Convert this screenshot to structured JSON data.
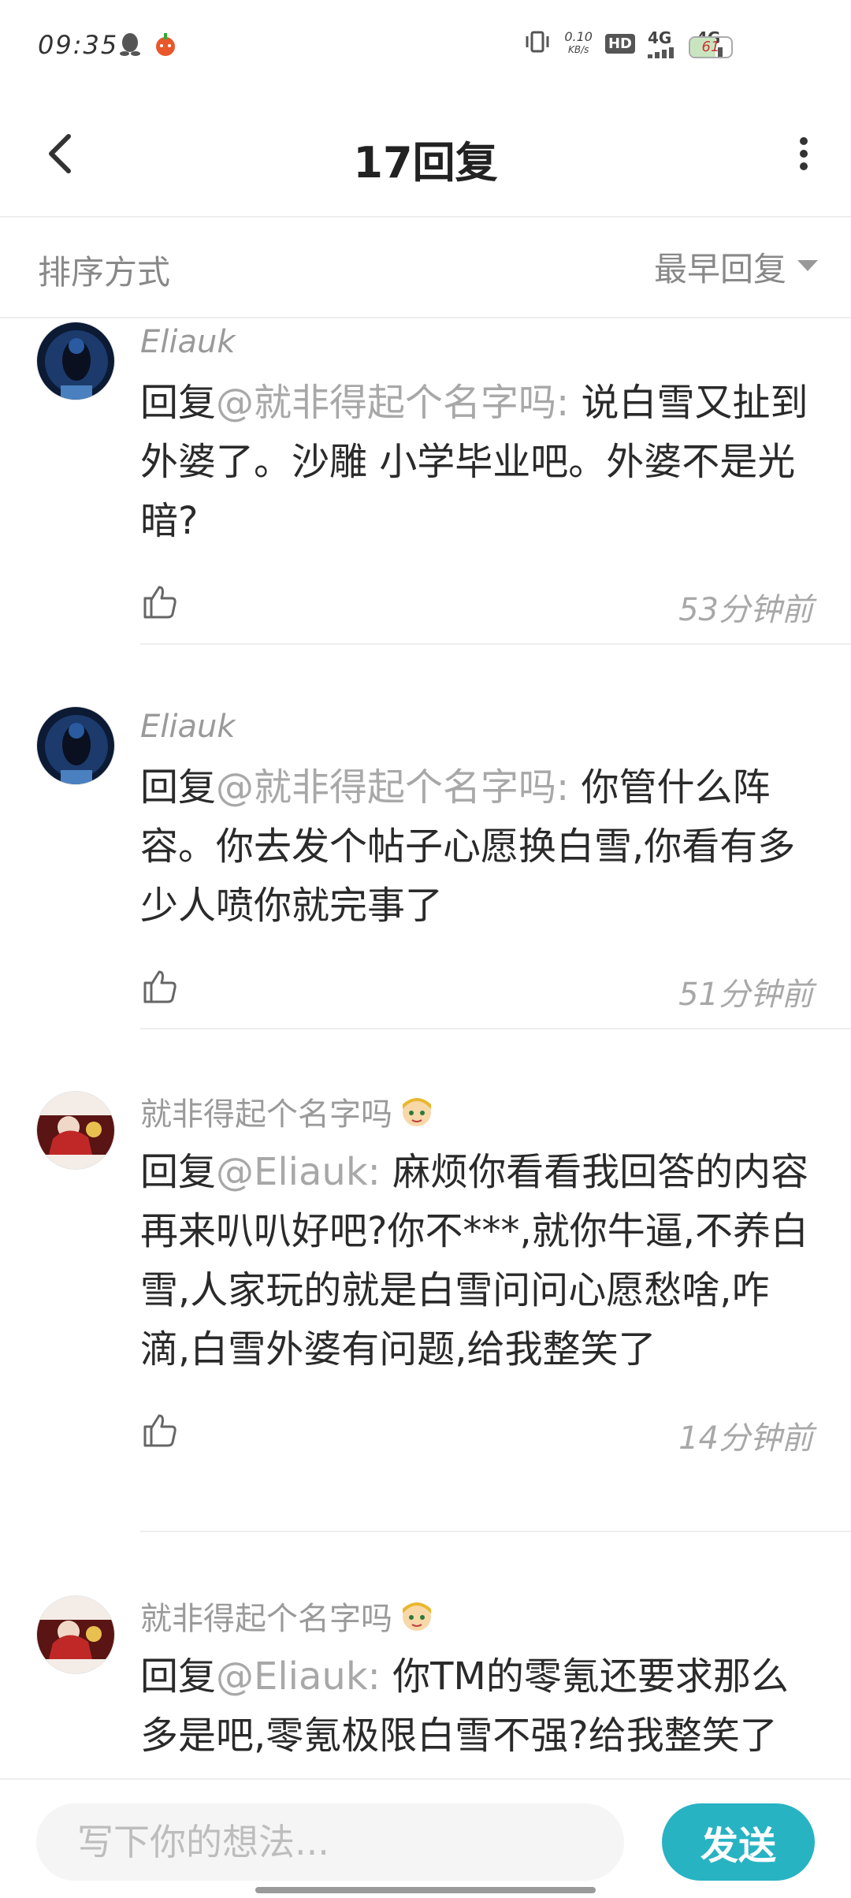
{
  "status_bar": {
    "time": "09:35",
    "speed_value": "0.10",
    "speed_unit": "KB/s",
    "hd_label": "HD",
    "net1": "4G",
    "net2": "4G",
    "battery_level": "61",
    "icons": [
      "qq-penguin-icon",
      "app-notification-icon",
      "vibrate-icon",
      "signal-icon",
      "battery-icon"
    ]
  },
  "header": {
    "title": "17回复",
    "back_icon": "chevron-left-icon",
    "more_icon": "more-vertical-icon"
  },
  "sort": {
    "label": "排序方式",
    "value": "最早回复"
  },
  "comments": [
    {
      "author": "Eliauk",
      "prefix": "回复",
      "mention": "@就非得起个名字吗:",
      "text": " 说白雪又扯到外婆了。沙雕 小学毕业吧。外婆不是光暗?",
      "time": "53分钟前",
      "avatar_color": "#1a3a6a"
    },
    {
      "author": "Eliauk",
      "prefix": "回复",
      "mention": "@就非得起个名字吗:",
      "text": " 你管什么阵容。你去发个帖子心愿换白雪,你看有多少人喷你就完事了",
      "time": "51分钟前",
      "avatar_color": "#1a3a6a"
    },
    {
      "author": "就非得起个名字吗",
      "prefix": "回复",
      "mention": "@Eliauk:",
      "text": " 麻烦你看看我回答的内容再来叭叭好吧?你不***,就你牛逼,不养白雪,人家玩的就是白雪问问心愿愁啥,咋滴,白雪外婆有问题,给我整笑了",
      "time": "14分钟前",
      "avatar_color": "#7a2020"
    },
    {
      "author": "就非得起个名字吗",
      "prefix": "回复",
      "mention": "@Eliauk:",
      "text": " 你TM的零氪还要求那么多是吧,零氪极限白雪不强?给我整笑了",
      "time": "",
      "avatar_color": "#7a2020"
    }
  ],
  "composer": {
    "placeholder": "写下你的想法...",
    "send_label": "发送",
    "accent": "#28b3c3"
  }
}
